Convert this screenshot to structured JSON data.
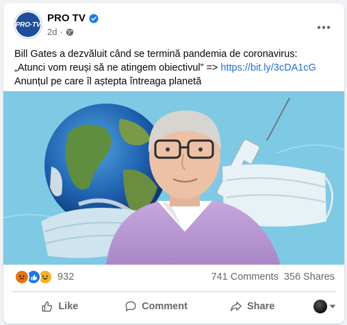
{
  "post": {
    "page_name": "PRO TV",
    "avatar_text": "PRO·TV",
    "time": "2d",
    "meta_sep": "·",
    "text_line1": "Bill Gates a dezvăluit când se termină pandemia de coronavirus:",
    "text_line2": "„Atunci vom reuși să ne atingem obiectivul” => ",
    "link": "https://bit.ly/3cDA1cG",
    "text_line3": "Anunțul pe care îl aștepta întreaga planetă"
  },
  "stats": {
    "reactions_count": "932",
    "comments": "741 Comments",
    "shares": "356 Shares"
  },
  "actions": {
    "like": "Like",
    "comment": "Comment",
    "share": "Share"
  },
  "colors": {
    "accent": "#1877f2",
    "link": "#216fdb",
    "image_background": "#7ec9e4"
  },
  "icons": [
    "verified-badge-icon",
    "globe-icon",
    "more-options-icon",
    "angry-reaction-icon",
    "like-reaction-icon",
    "haha-reaction-icon",
    "thumbs-up-icon",
    "comment-bubble-icon",
    "share-arrow-icon",
    "chevron-down-icon"
  ]
}
